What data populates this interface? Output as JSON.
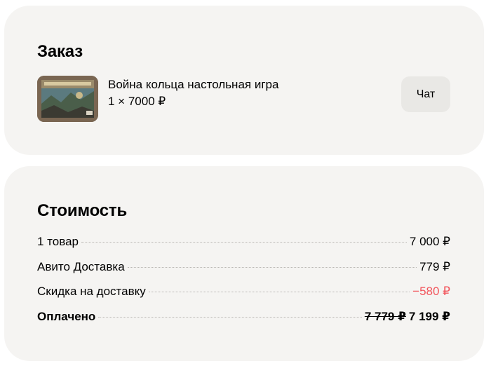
{
  "order": {
    "title": "Заказ",
    "item": {
      "title": "Война кольца настольная игра",
      "quantity_price": "1 × 7000 ₽",
      "image_icon": "board-game-box-photo"
    },
    "chat_label": "Чат"
  },
  "cost": {
    "title": "Стоимость",
    "rows": [
      {
        "label": "1 товар",
        "value": "7 000 ₽"
      },
      {
        "label": "Авито Доставка",
        "value": "779 ₽"
      },
      {
        "label": "Скидка на доставку",
        "value": "−580 ₽"
      }
    ],
    "total": {
      "label": "Оплачено",
      "old_value": "7 779 ₽",
      "value": "7 199 ₽"
    }
  },
  "colors": {
    "card_bg": "#f5f4f2",
    "button_bg": "#e9e8e5",
    "discount": "#f2545b"
  }
}
